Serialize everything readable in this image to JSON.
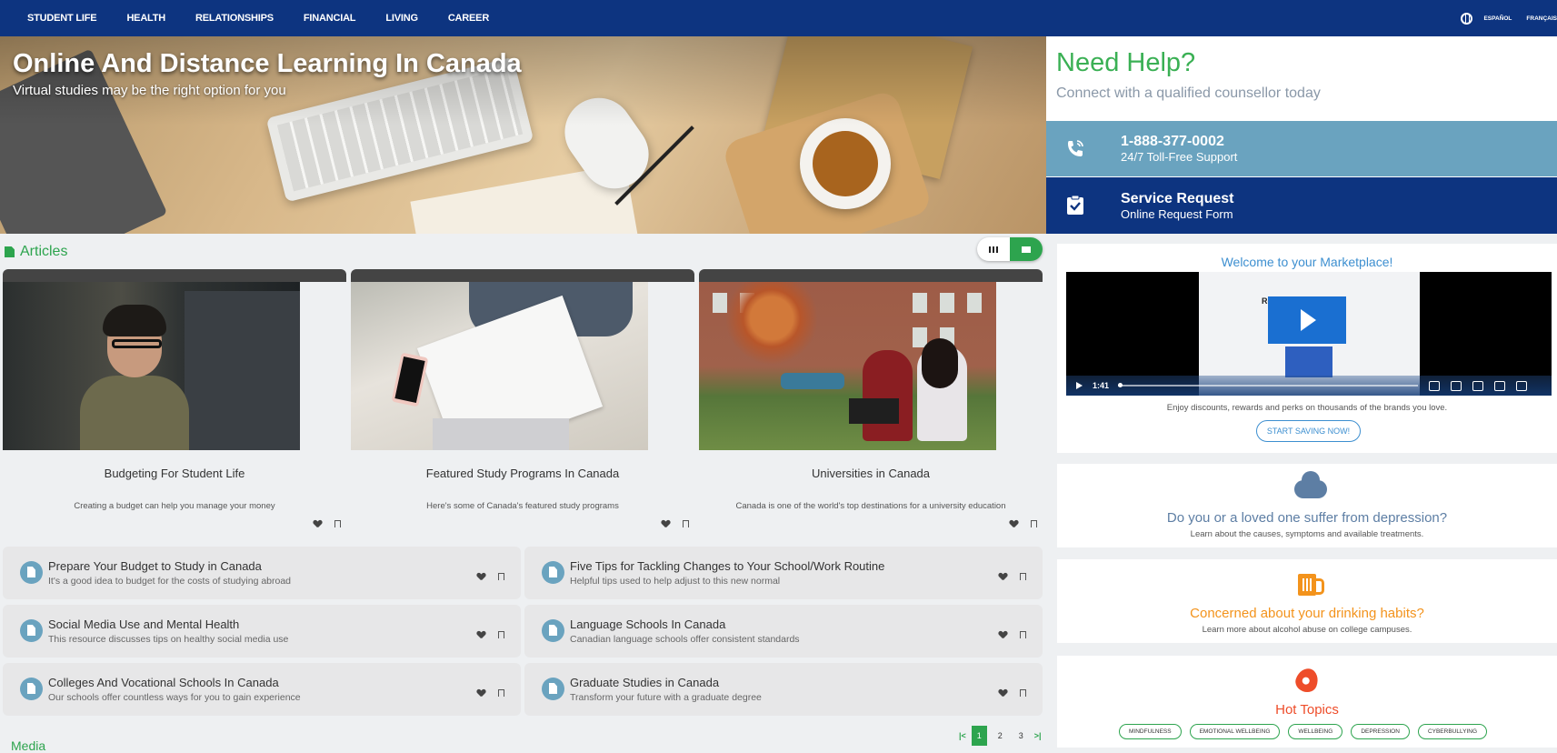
{
  "nav": {
    "items": [
      "STUDENT LIFE",
      "HEALTH",
      "RELATIONSHIPS",
      "FINANCIAL",
      "LIVING",
      "CAREER"
    ],
    "languages": [
      "ESPAÑOL",
      "FRANÇAIS"
    ]
  },
  "hero": {
    "title": "Online And Distance Learning In Canada",
    "subtitle": "Virtual studies may be the right option for you"
  },
  "help": {
    "title": "Need Help?",
    "subtitle": "Connect with a qualified counsellor today",
    "phone": {
      "number": "1-888-377-0002",
      "label": "24/7 Toll-Free Support"
    },
    "service": {
      "title": "Service Request",
      "label": "Online Request Form"
    }
  },
  "articles": {
    "heading": "Articles",
    "cards": [
      {
        "title": "Budgeting For Student Life",
        "desc": "Creating a budget can help you manage your money"
      },
      {
        "title": "Featured Study Programs In Canada",
        "desc": "Here's some of Canada's featured study programs"
      },
      {
        "title": "Universities in Canada",
        "desc": "Canada is one of the world's top destinations for a university education"
      }
    ],
    "list": [
      {
        "title": "Prepare Your Budget to Study in Canada",
        "desc": "It's a good idea to budget for the costs of studying abroad"
      },
      {
        "title": "Five Tips for Tackling Changes to Your School/Work Routine",
        "desc": "Helpful tips used to help adjust to this new normal"
      },
      {
        "title": "Social Media Use and Mental Health",
        "desc": "This resource discusses tips on healthy social media use"
      },
      {
        "title": "Language Schools In Canada",
        "desc": "Canadian language schools offer consistent standards"
      },
      {
        "title": "Colleges And Vocational Schools In Canada",
        "desc": "Our schools offer countless ways for you to gain experience"
      },
      {
        "title": "Graduate Studies in Canada",
        "desc": "Transform your future with a graduate degree"
      }
    ],
    "pagination": {
      "first": "|<",
      "pages": [
        "1",
        "2",
        "3"
      ],
      "last": ">|",
      "current": "1"
    }
  },
  "media": {
    "heading": "Media"
  },
  "marketplace": {
    "title": "Welcome to your Marketplace!",
    "video": {
      "time": "1:41",
      "caption_text": "Re...y."
    },
    "desc": "Enjoy discounts, rewards and perks on thousands of the brands you love.",
    "button": "START SAVING NOW!"
  },
  "depression": {
    "title": "Do you or a loved one suffer from depression?",
    "desc": "Learn about the causes, symptoms and available treatments.",
    "color": "#5d7ea4"
  },
  "drinking": {
    "title": "Concerned about your drinking habits?",
    "desc": "Learn more about alcohol abuse on college campuses.",
    "color": "#f3931c"
  },
  "hot_topics": {
    "title": "Hot Topics",
    "color": "#ee4d2a",
    "chips": [
      "MINDFULNESS",
      "EMOTIONAL WELLBEING",
      "WELLBEING",
      "DEPRESSION",
      "CYBERBULLYING"
    ]
  },
  "colors": {
    "nav": "#0d3480",
    "accent_green": "#2da44e",
    "help_phone_row": "#6aa3bf"
  }
}
